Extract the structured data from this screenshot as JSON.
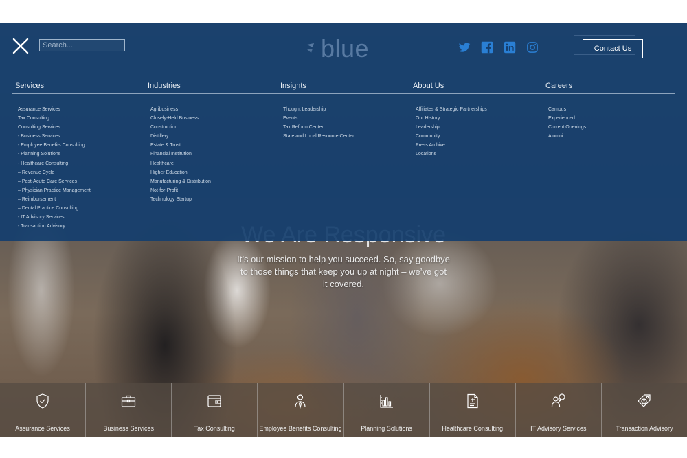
{
  "header": {
    "search_placeholder": "Search...",
    "logo_text": "blue",
    "contact_label": "Contact Us",
    "socials": [
      "twitter-icon",
      "facebook-icon",
      "linkedin-icon",
      "instagram-icon"
    ]
  },
  "menu": {
    "columns": [
      {
        "title": "Services",
        "items": [
          "Assurance Services",
          "Tax Consulting",
          "Consulting Services",
          "- Business Services",
          "- Employee Benefits Consulting",
          "- Planning Solutions",
          "- Healthcare Consulting",
          "– Revenue Cycle",
          "– Post-Acute Care Services",
          "– Physician Practice Management",
          "– Reimbursement",
          "– Dental Practice Consulting",
          "- IT Advisory Services",
          "- Transaction Advisory"
        ]
      },
      {
        "title": "Industries",
        "items": [
          "Agribusiness",
          "Closely-Held Business",
          "Construction",
          "Distillery",
          "Estate & Trust",
          "Financial Institution",
          "Healthcare",
          "Higher Education",
          "Manufacturing & Distribution",
          "Not-for-Profit",
          "Technology Startup"
        ]
      },
      {
        "title": "Insights",
        "items": [
          "Thought Leadership",
          "Events",
          "Tax Reform Center",
          "State and Local Resource Center"
        ]
      },
      {
        "title": "About Us",
        "items": [
          "Affiliates & Strategic Partnerships",
          "Our History",
          "Leadership",
          "Community",
          "Press Archive",
          "Locations"
        ]
      },
      {
        "title": "Careers",
        "items": [
          "Campus",
          "Experienced",
          "Current Openings",
          "Alumni"
        ]
      }
    ]
  },
  "hero": {
    "title": "We Are Responsive",
    "subtitle": "It’s our mission to help you succeed. So, say goodbye to those things that keep you up at night – we’ve got it covered."
  },
  "tiles": [
    {
      "label": "Assurance Services",
      "icon": "shield-check-icon"
    },
    {
      "label": "Business Services",
      "icon": "briefcase-icon"
    },
    {
      "label": "Tax Consulting",
      "icon": "wallet-icon"
    },
    {
      "label": "Employee Benefits Consulting",
      "icon": "person-icon"
    },
    {
      "label": "Planning Solutions",
      "icon": "bar-chart-icon"
    },
    {
      "label": "Healthcare Consulting",
      "icon": "medical-document-icon"
    },
    {
      "label": "IT Advisory Services",
      "icon": "advisor-chat-icon"
    },
    {
      "label": "Transaction Advisory",
      "icon": "price-tag-icon"
    }
  ],
  "colors": {
    "menu_bg": "#143e6e",
    "accent": "#2a7fd4",
    "tile_bg": "#554b42"
  }
}
